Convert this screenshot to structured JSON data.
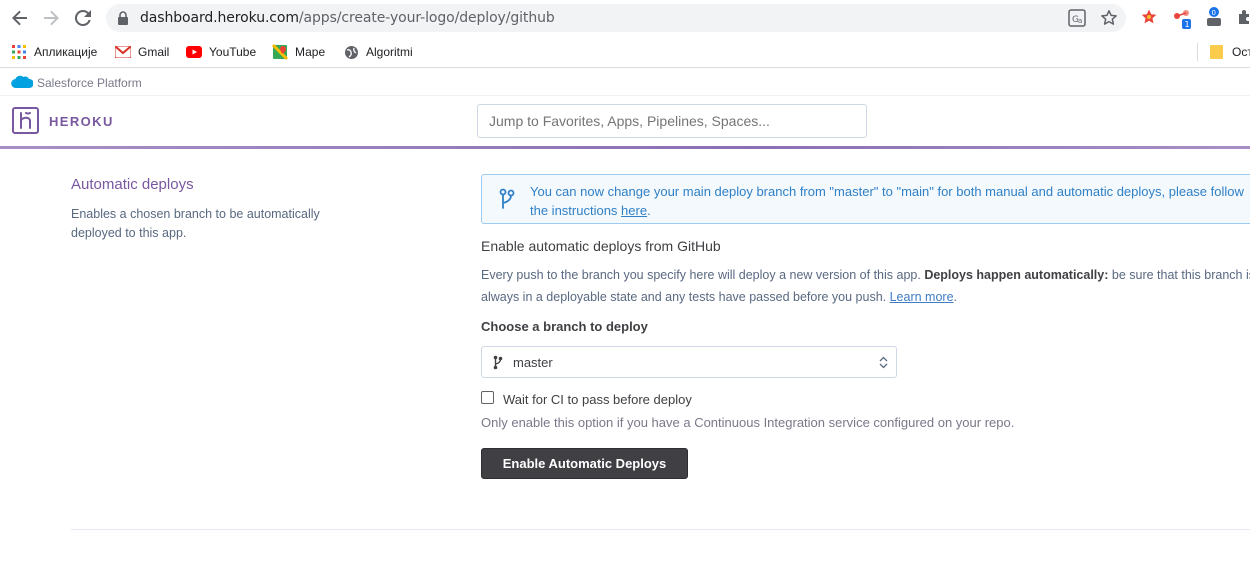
{
  "browser": {
    "url_domain": "dashboard.heroku.com",
    "url_path": "/apps/create-your-logo/deploy/github",
    "extension_badge": "1"
  },
  "bookmarks": [
    {
      "label": "Апликације",
      "icon": "apps-grid-icon"
    },
    {
      "label": "Gmail",
      "icon": "gmail-icon"
    },
    {
      "label": "YouTube",
      "icon": "youtube-icon"
    },
    {
      "label": "Маре",
      "icon": "maps-icon"
    },
    {
      "label": "Algoritmi",
      "icon": "globe-icon"
    }
  ],
  "bookmarks_overflow": "Ост",
  "salesforce": {
    "label": "Salesforce Platform"
  },
  "heroku": {
    "name": "HEROKU",
    "search_placeholder": "Jump to Favorites, Apps, Pipelines, Spaces..."
  },
  "section": {
    "title": "Automatic deploys",
    "description": "Enables a chosen branch to be automatically deployed to this app."
  },
  "notice": {
    "text": "You can now change your main deploy branch from \"master\" to \"main\" for both manual and automatic deploys, please follow the instructions ",
    "link": "here",
    "tail": "."
  },
  "enable": {
    "title": "Enable automatic deploys from GitHub",
    "desc_start": "Every push to the branch you specify here will deploy a new version of this app. ",
    "desc_bold": "Deploys happen automatically:",
    "desc_end": " be sure that this branch is always in a deployable state and any tests have passed before you push. ",
    "learn_more": "Learn more",
    "tail": "."
  },
  "branch": {
    "label": "Choose a branch to deploy",
    "selected": "master"
  },
  "ci": {
    "label": "Wait for CI to pass before deploy",
    "hint": "Only enable this option if you have a Continuous Integration service configured on your repo.",
    "checked": false
  },
  "deploy_button": "Enable Automatic Deploys",
  "colors": {
    "heroku_purple": "#79589f",
    "notice_blue": "#2f80c6",
    "button_dark": "#3f3f44"
  }
}
